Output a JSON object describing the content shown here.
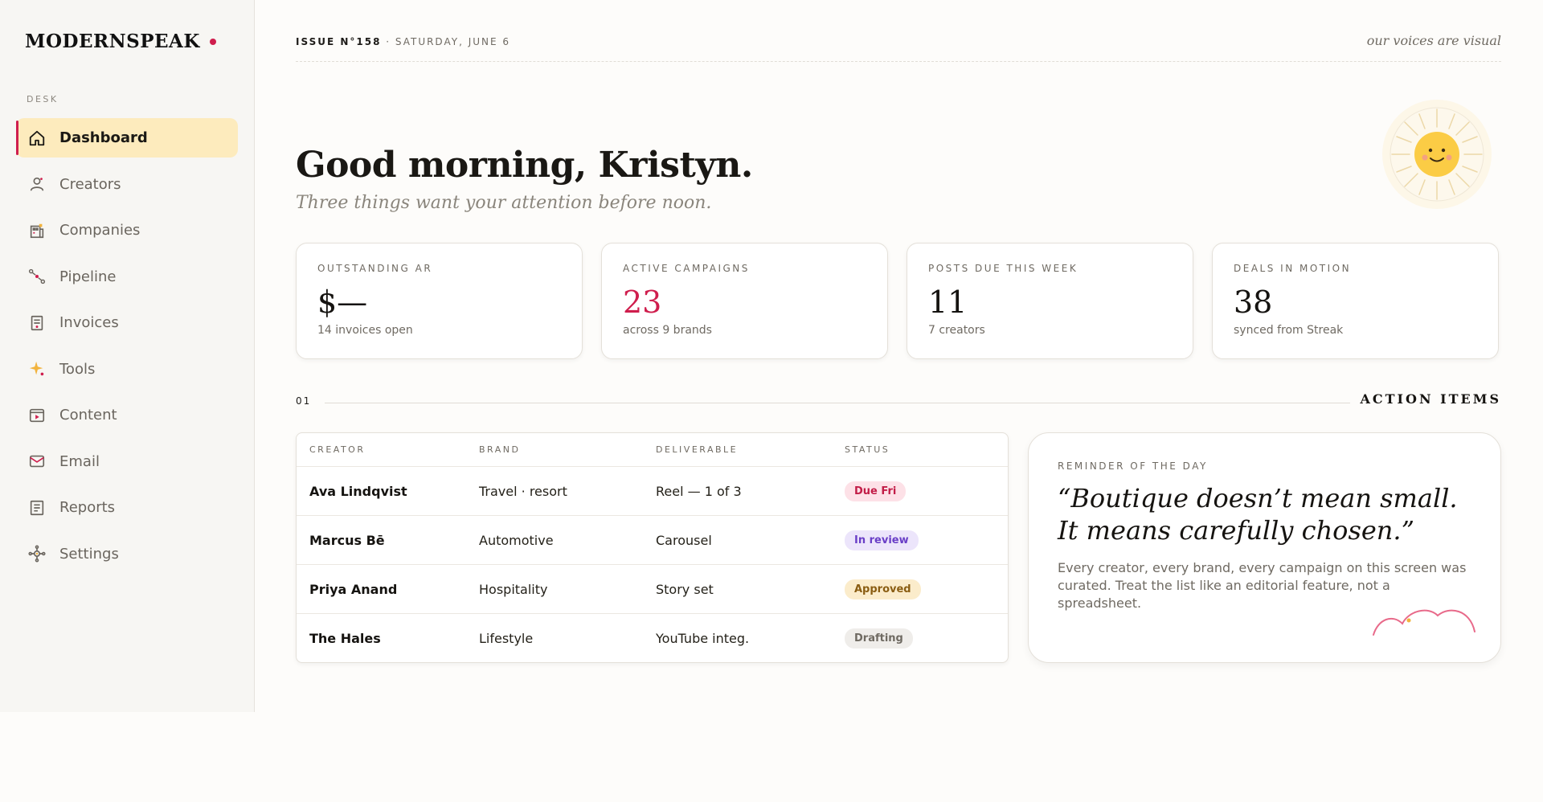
{
  "brand": {
    "name": "MODERNSPEAK",
    "accent_color": "#cf1e4d"
  },
  "sidebar": {
    "section_label": "DESK",
    "items": [
      {
        "label": "Dashboard",
        "icon": "home-icon",
        "active": true
      },
      {
        "label": "Creators",
        "icon": "person-icon",
        "active": false
      },
      {
        "label": "Companies",
        "icon": "building-icon",
        "active": false
      },
      {
        "label": "Pipeline",
        "icon": "pipeline-icon",
        "active": false
      },
      {
        "label": "Invoices",
        "icon": "invoice-icon",
        "active": false
      },
      {
        "label": "Tools",
        "icon": "sparkle-icon",
        "active": false
      },
      {
        "label": "Content",
        "icon": "video-icon",
        "active": false
      },
      {
        "label": "Email",
        "icon": "mail-icon",
        "active": false
      },
      {
        "label": "Reports",
        "icon": "report-icon",
        "active": false
      },
      {
        "label": "Settings",
        "icon": "settings-icon",
        "active": false
      }
    ]
  },
  "header": {
    "issue": "ISSUE N°158",
    "date": " · SATURDAY, JUNE 6",
    "tagline": "our voices are visual"
  },
  "hero": {
    "greeting": "Good morning, Kristyn.",
    "subtitle": "Three things want your attention before noon."
  },
  "stats": [
    {
      "label": "OUTSTANDING AR",
      "value": "$—",
      "sub": "14 invoices open",
      "accent": false
    },
    {
      "label": "ACTIVE CAMPAIGNS",
      "value": "23",
      "sub": "across 9 brands",
      "accent": true
    },
    {
      "label": "POSTS DUE THIS WEEK",
      "value": "11",
      "sub": "7 creators",
      "accent": false
    },
    {
      "label": "DEALS IN MOTION",
      "value": "38",
      "sub": "synced from Streak",
      "accent": false
    }
  ],
  "section": {
    "number": "01",
    "title": "ACTION ITEMS"
  },
  "table": {
    "columns": [
      "CREATOR",
      "BRAND",
      "DELIVERABLE",
      "STATUS"
    ],
    "rows": [
      {
        "creator": "Ava Lindqvist",
        "brand": "Travel · resort",
        "deliverable": "Reel — 1 of 3",
        "status": "Due Fri",
        "status_bg": "#fde1e7",
        "status_fg": "#c21d47"
      },
      {
        "creator": "Marcus Bē",
        "brand": "Automotive",
        "deliverable": "Carousel",
        "status": "In review",
        "status_bg": "#ece5fb",
        "status_fg": "#6a3fc7"
      },
      {
        "creator": "Priya Anand",
        "brand": "Hospitality",
        "deliverable": "Story set",
        "status": "Approved",
        "status_bg": "#fbeccb",
        "status_fg": "#8a5d12"
      },
      {
        "creator": "The Hales",
        "brand": "Lifestyle",
        "deliverable": "YouTube integ.",
        "status": "Drafting",
        "status_bg": "#efedea",
        "status_fg": "#6f6a62"
      }
    ]
  },
  "reminder": {
    "label": "REMINDER OF THE DAY",
    "quote": "“Boutique doesn’t mean small. It means carefully chosen.”",
    "body": "Every creator, every brand, every campaign on this screen was curated. Treat the list like an editorial feature, not a spreadsheet."
  }
}
